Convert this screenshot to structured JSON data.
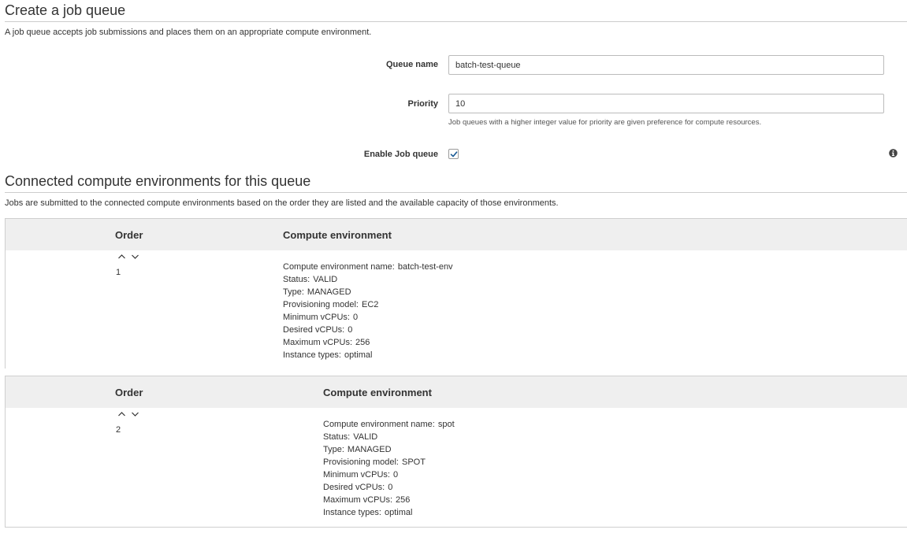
{
  "page": {
    "title": "Create a job queue",
    "description": "A job queue accepts job submissions and places them on an appropriate compute environment."
  },
  "form": {
    "queue_name": {
      "label": "Queue name",
      "value": "batch-test-queue"
    },
    "priority": {
      "label": "Priority",
      "value": "10",
      "help": "Job queues with a higher integer value for priority are given preference for compute resources."
    },
    "enable": {
      "label": "Enable Job queue",
      "checked": true
    }
  },
  "environments_section": {
    "title": "Connected compute environments for this queue",
    "description": "Jobs are submitted to the connected compute environments based on the order they are listed and the available capacity of those environments."
  },
  "environments": [
    {
      "order_header": "Order",
      "env_header": "Compute environment",
      "order": "1",
      "details": [
        {
          "label": "Compute environment name:",
          "value": "batch-test-env"
        },
        {
          "label": "Status:",
          "value": "VALID"
        },
        {
          "label": "Type:",
          "value": "MANAGED"
        },
        {
          "label": "Provisioning model:",
          "value": "EC2"
        },
        {
          "label": "Minimum vCPUs:",
          "value": "0"
        },
        {
          "label": "Desired vCPUs:",
          "value": "0"
        },
        {
          "label": "Maximum vCPUs:",
          "value": "256"
        },
        {
          "label": "Instance types:",
          "value": "optimal"
        }
      ]
    },
    {
      "order_header": "Order",
      "env_header": "Compute environment",
      "order": "2",
      "details": [
        {
          "label": "Compute environment name:",
          "value": "spot"
        },
        {
          "label": "Status:",
          "value": "VALID"
        },
        {
          "label": "Type:",
          "value": "MANAGED"
        },
        {
          "label": "Provisioning model:",
          "value": "SPOT"
        },
        {
          "label": "Minimum vCPUs:",
          "value": "0"
        },
        {
          "label": "Desired vCPUs:",
          "value": "0"
        },
        {
          "label": "Maximum vCPUs:",
          "value": "256"
        },
        {
          "label": "Instance types:",
          "value": "optimal"
        }
      ]
    }
  ],
  "icons": {
    "move_up": "chevron-up-icon",
    "move_down": "chevron-down-icon",
    "checkbox": "checkmark-icon",
    "info": "info-icon"
  },
  "colors": {
    "checkmark": "#1a5b96",
    "header_bg": "#efefef",
    "rule": "#cccccc"
  }
}
